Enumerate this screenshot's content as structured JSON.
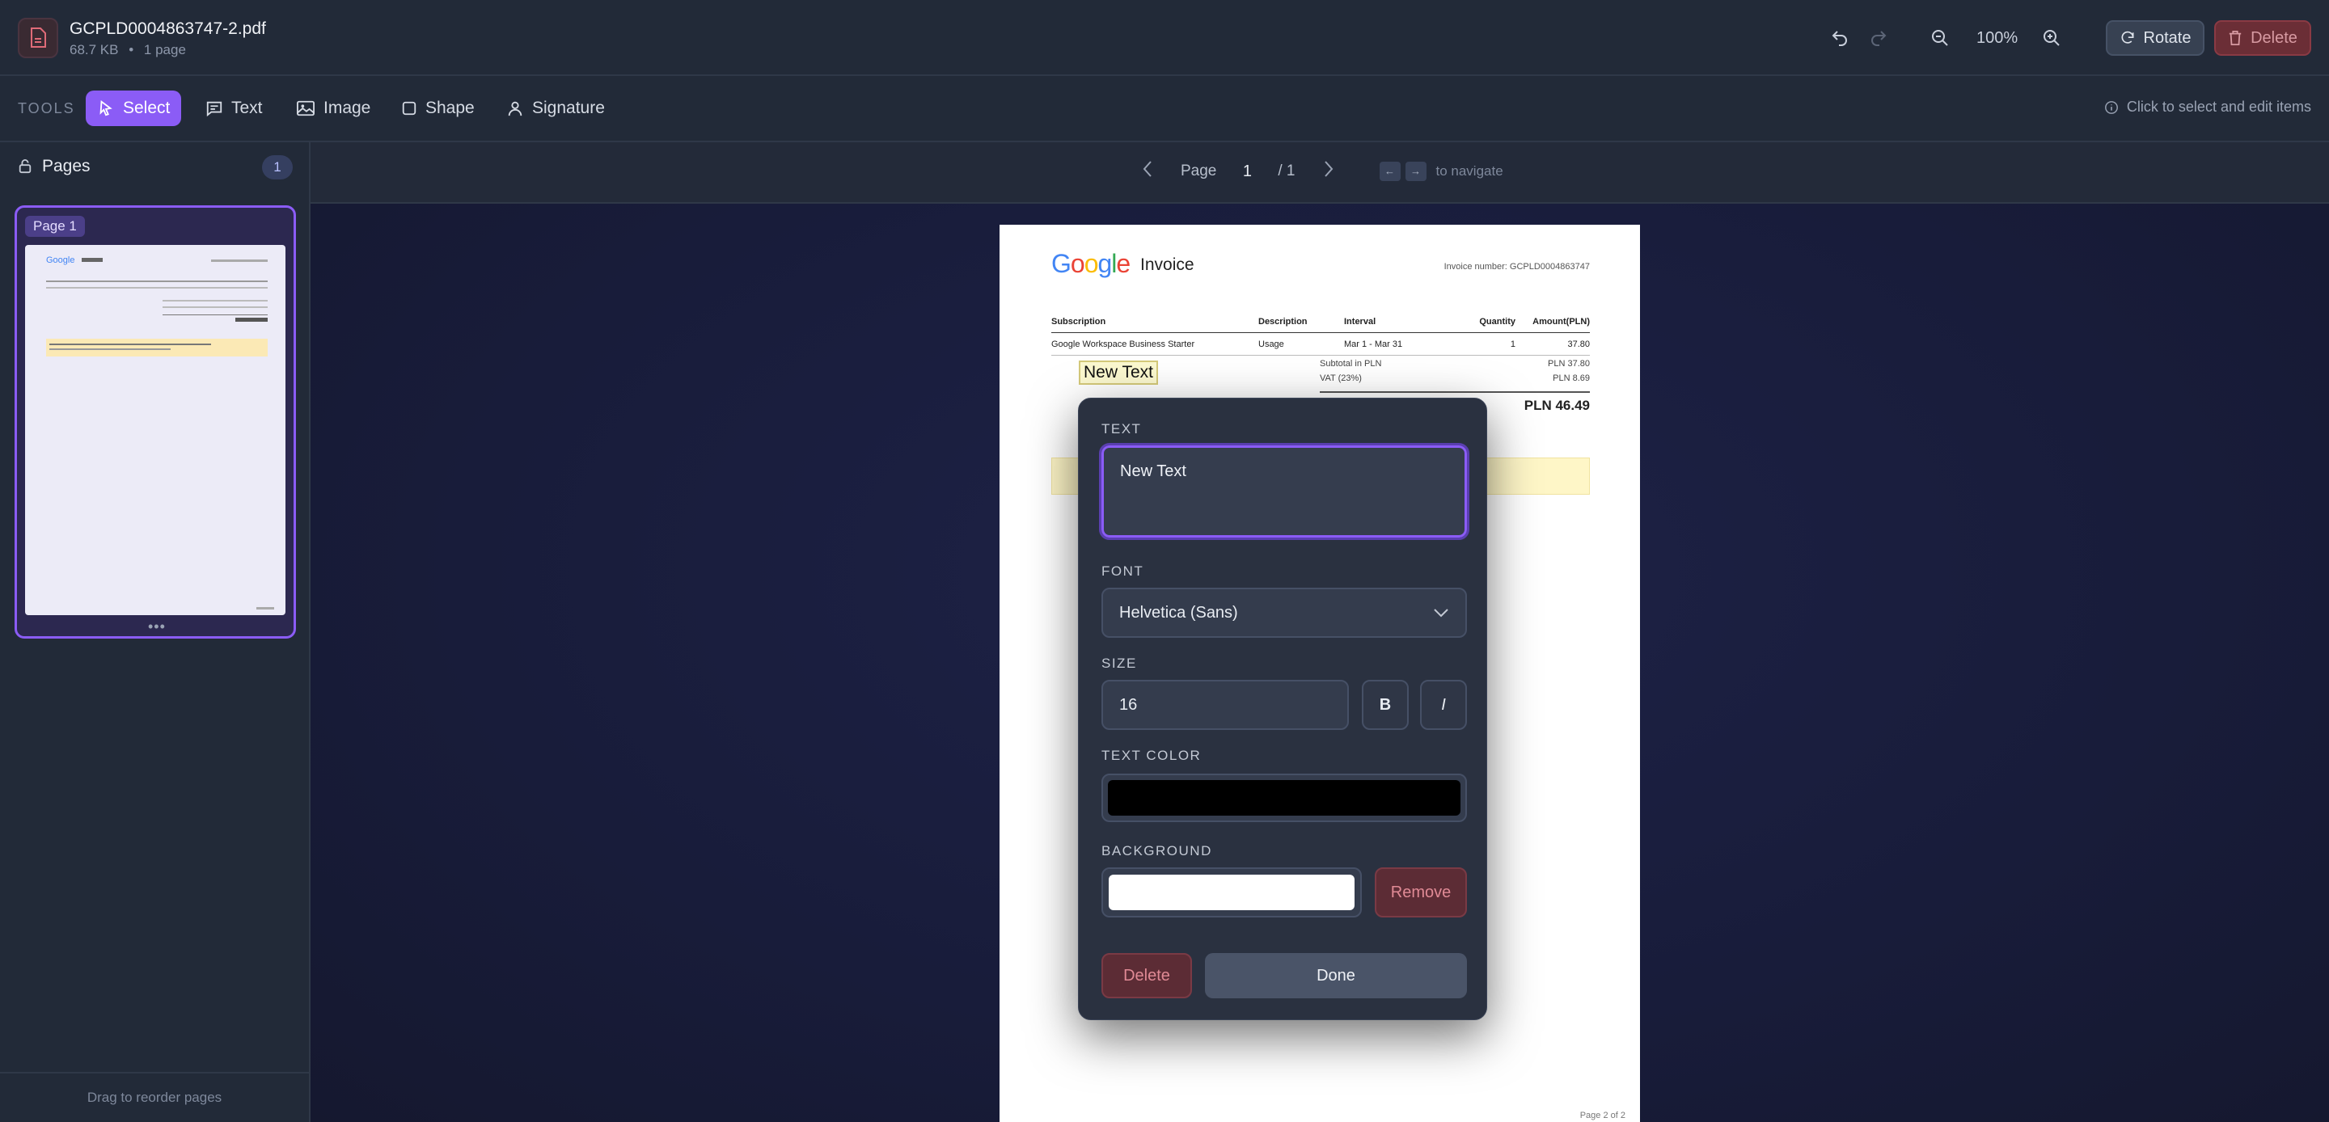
{
  "file": {
    "name": "GCPLD0004863747-2.pdf",
    "size": "68.7 KB",
    "pages_meta": "1 page"
  },
  "toolbar": {
    "zoom": "100%",
    "rotate_label": "Rotate",
    "delete_label": "Delete"
  },
  "tools": {
    "label": "TOOLS",
    "items": [
      {
        "label": "Select",
        "icon": "pointer-icon"
      },
      {
        "label": "Text",
        "icon": "text-icon"
      },
      {
        "label": "Image",
        "icon": "image-icon"
      },
      {
        "label": "Shape",
        "icon": "shape-icon"
      },
      {
        "label": "Signature",
        "icon": "signature-icon"
      }
    ],
    "hint": "Click to select and edit items"
  },
  "sidebar": {
    "title": "Pages",
    "count": "1",
    "thumb_label": "Page 1",
    "footer": "Drag to reorder pages"
  },
  "nav": {
    "page_label": "Page",
    "current": "1",
    "total": "/ 1",
    "keys": [
      "←",
      "→"
    ],
    "hint": "to navigate"
  },
  "document": {
    "logo": "Google",
    "title": "Invoice",
    "invoice_number": "Invoice number: GCPLD0004863747",
    "headers": [
      "Subscription",
      "Description",
      "Interval",
      "Quantity",
      "Amount(PLN)"
    ],
    "rows": [
      [
        "Google Workspace Business Starter",
        "Usage",
        "Mar 1 - Mar 31",
        "1",
        "37.80"
      ]
    ],
    "subtotal_label": "Subtotal in PLN",
    "subtotal_value": "PLN 37.80",
    "vat_label": "VAT (23%)",
    "vat_value": "PLN 8.69",
    "total": "PLN 46.49",
    "new_text": "New Text",
    "footer": "Page 2 of 2"
  },
  "popover": {
    "text_label": "TEXT",
    "text_value": "New Text",
    "font_label": "FONT",
    "font_value": "Helvetica (Sans)",
    "size_label": "SIZE",
    "size_value": "16",
    "bold": "B",
    "italic": "I",
    "color_label": "TEXT COLOR",
    "text_color": "#000000",
    "bg_label": "BACKGROUND",
    "bg_color": "#ffffff",
    "remove_label": "Remove",
    "delete_label": "Delete",
    "done_label": "Done"
  },
  "colors": {
    "accent": "#8b5cf6",
    "danger": "#6b2e36",
    "panel": "#222a38"
  }
}
